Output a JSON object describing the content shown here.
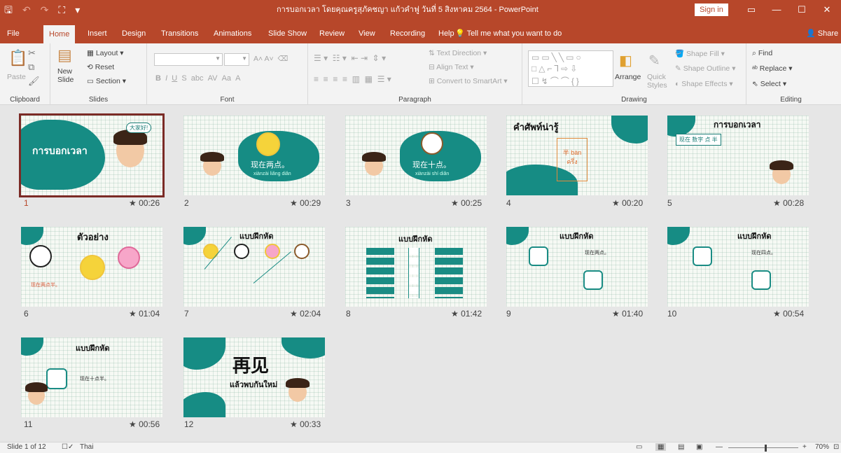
{
  "titlebar": {
    "title": "การบอกเวลา โดยคุณครูสุภัคชญา แก้วคำฟู วันที่ 5 สิงหาคม 2564 - PowerPoint",
    "sign_in": "Sign in",
    "controls": [
      "▭",
      "—",
      "☐",
      "✕"
    ]
  },
  "tabs": [
    "File",
    "Home",
    "Insert",
    "Design",
    "Transitions",
    "Animations",
    "Slide Show",
    "Review",
    "View",
    "Recording",
    "Help"
  ],
  "tell_me": "Tell me what you want to do",
  "share": "Share",
  "ribbon": {
    "clipboard": {
      "label": "Clipboard",
      "paste": "Paste"
    },
    "slides": {
      "label": "Slides",
      "new_slide": "New",
      "new_slide2": "Slide",
      "layout": "Layout",
      "reset": "Reset",
      "section": "Section"
    },
    "font": {
      "label": "Font"
    },
    "paragraph": {
      "label": "Paragraph",
      "text_direction": "Text Direction",
      "align_text": "Align Text",
      "convert": "Convert to SmartArt"
    },
    "drawing": {
      "label": "Drawing",
      "arrange": "Arrange",
      "quick_styles": "Quick",
      "quick_styles2": "Styles",
      "shape_fill": "Shape Fill",
      "shape_outline": "Shape Outline",
      "shape_effects": "Shape Effects"
    },
    "editing": {
      "label": "Editing",
      "find": "Find",
      "replace": "Replace",
      "select": "Select"
    }
  },
  "slides": [
    {
      "num": "1",
      "time": "★ 00:26",
      "title": "การบอกเวลา",
      "sub": "大家好!"
    },
    {
      "num": "2",
      "time": "★ 00:29",
      "title": "现在两点。",
      "sub": "xiànzài liǎng diǎn"
    },
    {
      "num": "3",
      "time": "★ 00:25",
      "title": "现在十点。",
      "sub": "xiànzài shí diǎn"
    },
    {
      "num": "4",
      "time": "★ 00:20",
      "title": "คำศัพท์น่ารู้",
      "sub": "半 bàn ครึ่ง"
    },
    {
      "num": "5",
      "time": "★ 00:28",
      "title": "การบอกเวลา",
      "sub": "现在 数字 点 半"
    },
    {
      "num": "6",
      "time": "★ 01:04",
      "title": "ตัวอย่าง",
      "sub": "现在两点半。"
    },
    {
      "num": "7",
      "time": "★ 02:04",
      "title": "แบบฝึกหัด",
      "sub": ""
    },
    {
      "num": "8",
      "time": "★ 01:42",
      "title": "แบบฝึกหัด",
      "sub": ""
    },
    {
      "num": "9",
      "time": "★ 01:40",
      "title": "แบบฝึกหัด",
      "sub": "现在两点。"
    },
    {
      "num": "10",
      "time": "★ 00:54",
      "title": "แบบฝึกหัด",
      "sub": "现在四点。"
    },
    {
      "num": "11",
      "time": "★ 00:56",
      "title": "แบบฝึกหัด",
      "sub": "现在十点半。"
    },
    {
      "num": "12",
      "time": "★ 00:33",
      "title": "再见",
      "sub": "แล้วพบกันใหม่"
    }
  ],
  "status": {
    "slide_of": "Slide 1 of 12",
    "lang": "Thai",
    "zoom": "70%"
  }
}
